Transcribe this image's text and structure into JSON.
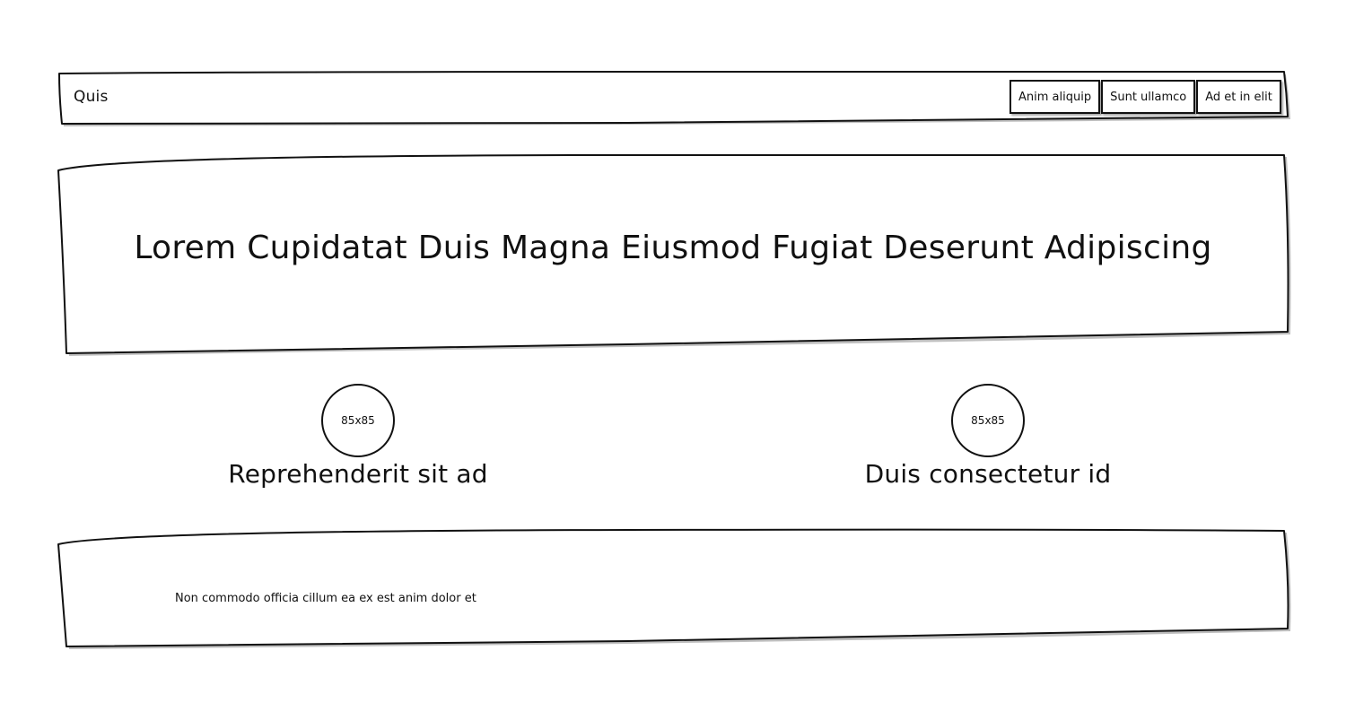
{
  "header": {
    "brand": "Quis",
    "nav": [
      {
        "label": "Anim aliquip"
      },
      {
        "label": "Sunt ullamco"
      },
      {
        "label": "Ad et in elit"
      }
    ]
  },
  "hero": {
    "title": "Lorem Cupidatat Duis Magna Eiusmod Fugiat Deserunt Adipiscing"
  },
  "features": [
    {
      "image_label": "85x85",
      "title": "Reprehenderit sit ad"
    },
    {
      "image_label": "85x85",
      "title": "Duis consectetur id"
    }
  ],
  "footer": {
    "text": "Non commodo officia cillum ea ex est anim dolor et"
  }
}
